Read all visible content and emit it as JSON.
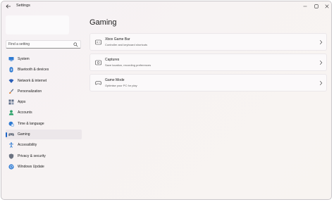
{
  "window": {
    "title": "Settings"
  },
  "search": {
    "placeholder": "Find a setting"
  },
  "sidebar": {
    "items": [
      {
        "label": "System",
        "icon": "display-icon",
        "color": "#2f7bd3"
      },
      {
        "label": "Bluetooth & devices",
        "icon": "bluetooth-icon",
        "color": "#2f7bd3"
      },
      {
        "label": "Network & internet",
        "icon": "wifi-icon",
        "color": "#2b5fb8"
      },
      {
        "label": "Personalization",
        "icon": "brush-icon",
        "color": "#d87a2f"
      },
      {
        "label": "Apps",
        "icon": "apps-icon",
        "color": "#5c6c86"
      },
      {
        "label": "Accounts",
        "icon": "person-icon",
        "color": "#2fa36b"
      },
      {
        "label": "Time & language",
        "icon": "globe-clock-icon",
        "color": "#2f7bd3"
      },
      {
        "label": "Gaming",
        "icon": "controller-icon",
        "color": "#6b7280"
      },
      {
        "label": "Accessibility",
        "icon": "accessibility-icon",
        "color": "#2f7bd3"
      },
      {
        "label": "Privacy & security",
        "icon": "shield-icon",
        "color": "#6b7280"
      },
      {
        "label": "Windows Update",
        "icon": "update-icon",
        "color": "#2f7bd3"
      }
    ],
    "selected_index": 7
  },
  "main": {
    "title": "Gaming",
    "cards": [
      {
        "title": "Xbox Game Bar",
        "subtitle": "Controller and keyboard shortcuts",
        "icon": "game-bar-icon"
      },
      {
        "title": "Captures",
        "subtitle": "Save location, recording preferences",
        "icon": "capture-icon"
      },
      {
        "title": "Game Mode",
        "subtitle": "Optimise your PC for play",
        "icon": "game-mode-icon"
      }
    ]
  },
  "colors": {
    "accent": "#1a63c7",
    "selected_bg": "#ece7ea"
  }
}
